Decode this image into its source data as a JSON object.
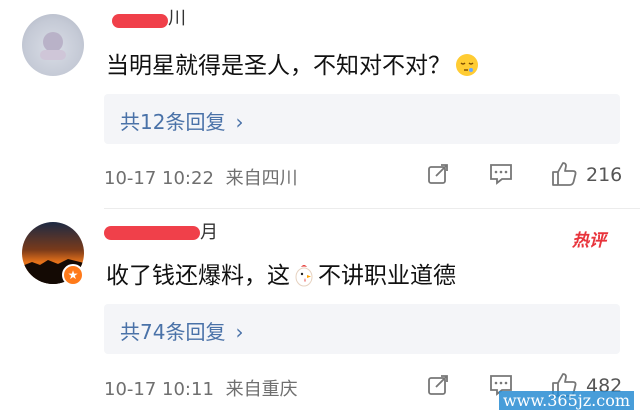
{
  "comments": [
    {
      "username_suffix": "川",
      "text": "当明星就得是圣人，不知对不对？",
      "emoji": "sleepy-face-emoji",
      "replies": "共12条回复",
      "date": "10-17 10:22",
      "location": "来自四川",
      "likes": "216"
    },
    {
      "username_suffix": "月",
      "text_before": "收了钱还爆料，这",
      "emoji": "chicken-emoji",
      "text_after": "不讲职业道德",
      "hot_tag": "热评",
      "replies": "共74条回复",
      "date": "10-17 10:11",
      "location": "来自重庆",
      "likes": "482"
    }
  ],
  "watermark": "www.365jz.com",
  "colors": {
    "link": "#4a72a8",
    "redact": "#f0404a",
    "hot": "#e8343c"
  }
}
